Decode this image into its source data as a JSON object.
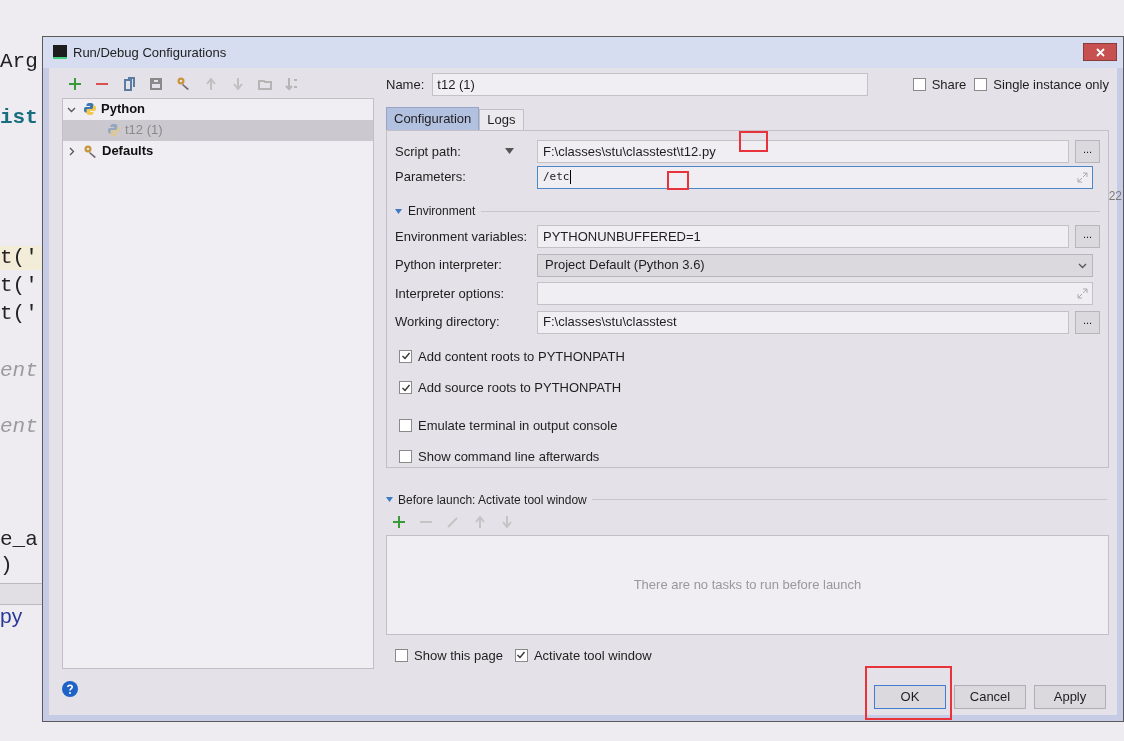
{
  "editor": {
    "lines": [
      {
        "text": "Arg",
        "kind": "code"
      },
      {
        "text": "ist",
        "kind": "keyword"
      },
      {
        "text": "t('",
        "kind": "current"
      },
      {
        "text": "t('",
        "kind": "code"
      },
      {
        "text": "t('",
        "kind": "code"
      },
      {
        "text": "ent",
        "kind": "comment"
      },
      {
        "text": "ent",
        "kind": "comment"
      },
      {
        "text": "e_a",
        "kind": "code"
      },
      {
        "text": ")",
        "kind": "code"
      },
      {
        "text": "py",
        "kind": "file"
      }
    ],
    "edge_text": "22"
  },
  "dialog": {
    "title": "Run/Debug Configurations",
    "tree": [
      {
        "label": "Python",
        "expanded": true,
        "children": [
          {
            "label": "t12 (1)",
            "selected": true
          }
        ]
      },
      {
        "label": "Defaults",
        "expanded": false
      }
    ],
    "name": {
      "label": "Name:",
      "value": "t12 (1)"
    },
    "options": [
      {
        "label": "Share",
        "checked": false
      },
      {
        "label": "Single instance only",
        "checked": false
      }
    ],
    "tabs": [
      {
        "label": "Configuration",
        "selected": true
      },
      {
        "label": "Logs",
        "selected": false
      }
    ],
    "fields": [
      {
        "kind": "path",
        "label": "Script path:",
        "value": "F:\\classes\\stu\\classtest\\t12.py",
        "button": "...",
        "focused": false
      },
      {
        "kind": "expand",
        "label": "Parameters:",
        "value": "/etc",
        "focused": true
      }
    ],
    "environment": {
      "title": "Environment",
      "expanded": true,
      "fields": [
        {
          "kind": "browse",
          "label": "Environment variables:",
          "value": "PYTHONUNBUFFERED=1",
          "button": "..."
        },
        {
          "kind": "combo",
          "label": "Python interpreter:",
          "value": "Project Default (Python 3.6)"
        },
        {
          "kind": "expand",
          "label": "Interpreter options:"
        },
        {
          "kind": "browse",
          "label": "Working directory:",
          "value": "F:\\classes\\stu\\classtest",
          "button": "..."
        }
      ]
    },
    "checkboxes": [
      {
        "label": "Add content roots to PYTHONPATH",
        "checked": true
      },
      {
        "label": "Add source roots to PYTHONPATH",
        "checked": true
      },
      {
        "label": "Emulate terminal in output console",
        "checked": false
      },
      {
        "label": "Show command line afterwards",
        "checked": false
      }
    ],
    "before_launch": {
      "title": "Before launch: Activate tool window",
      "expanded": true,
      "empty_text": "There are no tasks to run before launch"
    },
    "bottom_options": [
      {
        "label": "Show this page",
        "checked": false
      },
      {
        "label": "Activate tool window",
        "checked": true
      }
    ],
    "buttons": [
      {
        "label": "OK",
        "default": true
      },
      {
        "label": "Cancel",
        "default": false
      },
      {
        "label": "Apply",
        "default": false
      }
    ]
  }
}
